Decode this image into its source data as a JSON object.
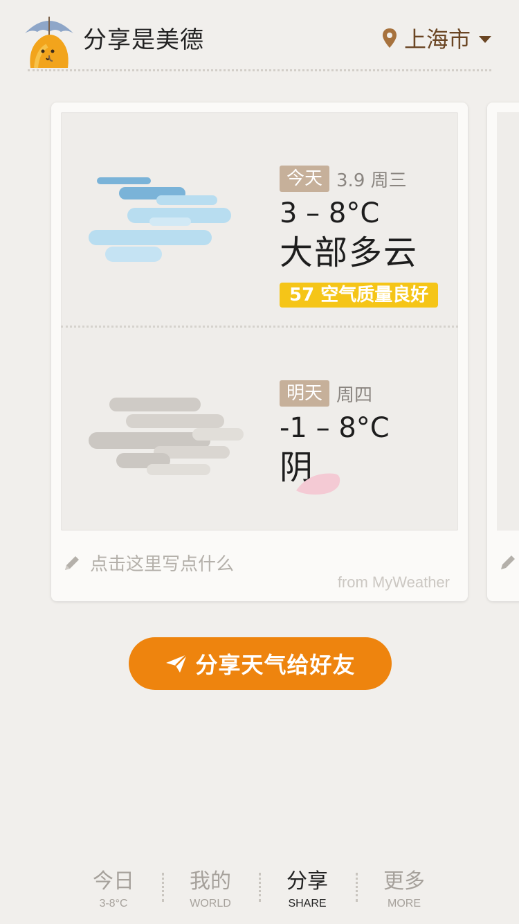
{
  "header": {
    "title": "分享是美德",
    "location": "上海市"
  },
  "card": {
    "today": {
      "badge": "今天",
      "date": "3.9 周三",
      "temp": "3 – 8°C",
      "condition": "大部多云",
      "aqi": "57 空气质量良好"
    },
    "tomorrow": {
      "badge": "明天",
      "date": "周四",
      "temp": "-1 – 8°C",
      "condition": "阴"
    },
    "note_placeholder": "点击这里写点什么",
    "watermark": "from MyWeather"
  },
  "share_button": {
    "label": "分享天气给好友"
  },
  "tabs": [
    {
      "label": "今日",
      "sub": "3-8°C"
    },
    {
      "label": "我的",
      "sub": "WORLD"
    },
    {
      "label": "分享",
      "sub": "SHARE",
      "active": true
    },
    {
      "label": "更多",
      "sub": "MORE"
    }
  ],
  "colors": {
    "accent": "#ee840e",
    "aqi_badge": "#f5c518",
    "day_badge": "#c6b09a",
    "location": "#6a4523"
  },
  "icons": [
    "umbrella-mascot-icon",
    "location-pin-icon",
    "dropdown-caret-icon",
    "pencil-icon",
    "send-icon",
    "cloud-icon"
  ]
}
